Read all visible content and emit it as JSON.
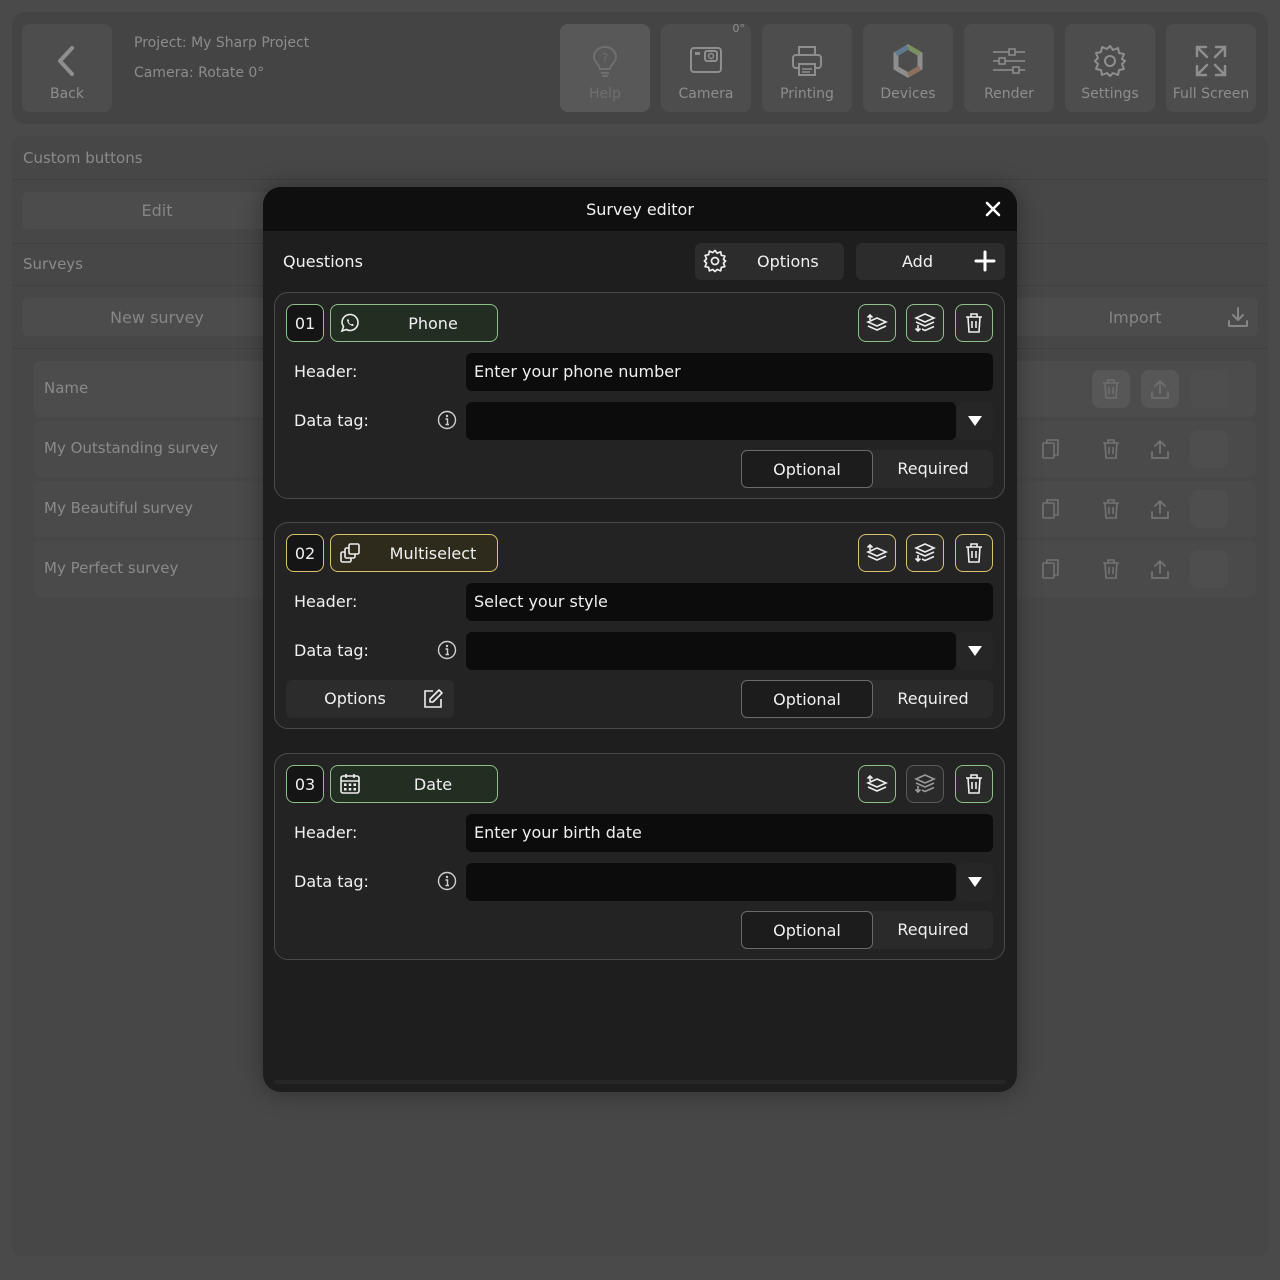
{
  "topbar": {
    "back_label": "Back",
    "project_line": "Project: My Sharp Project",
    "camera_line": "Camera: Rotate 0°",
    "camera_rotation_badge": "0°",
    "buttons": {
      "help": "Help",
      "camera": "Camera",
      "printing": "Printing",
      "devices": "Devices",
      "render": "Render",
      "settings": "Settings",
      "fullscreen": "Full Screen"
    },
    "icons": [
      "chevron-left-icon",
      "help-bulb-icon",
      "camera-icon",
      "printer-icon",
      "devices-icon",
      "sliders-icon",
      "gear-icon",
      "expand-icon"
    ]
  },
  "background": {
    "custom_buttons_title": "Custom buttons",
    "edit_label": "Edit",
    "surveys_title": "Surveys",
    "new_survey_label": "New survey",
    "import_label": "Import",
    "name_header": "Name",
    "surveys": [
      "My Outstanding survey",
      "My Beautiful survey",
      "My Perfect survey"
    ]
  },
  "modal": {
    "title": "Survey editor",
    "questions_label": "Questions",
    "options_label": "Options",
    "add_label": "Add",
    "header_label": "Header:",
    "data_tag_label": "Data tag:",
    "optional_label": "Optional",
    "required_label": "Required",
    "options_button_label": "Options",
    "questions": [
      {
        "number": "01",
        "type": "Phone",
        "type_icon": "whatsapp-phone-icon",
        "header": "Enter your phone number",
        "data_tag": "",
        "requirement": "Optional",
        "accent": "#8fbf8a"
      },
      {
        "number": "02",
        "type": "Multiselect",
        "type_icon": "multiselect-icon",
        "header": "Select your style",
        "data_tag": "",
        "requirement": "Optional",
        "accent": "#d9c36a"
      },
      {
        "number": "03",
        "type": "Date",
        "type_icon": "calendar-icon",
        "header": "Enter your birth date",
        "data_tag": "",
        "requirement": "Optional",
        "accent": "#8fbf8a"
      }
    ]
  },
  "colors": {
    "backdrop": "#4a4a4a",
    "modal_bg": "#1e1e1e",
    "modal_header": "#0f0f0f",
    "accent_green": "#8fbf8a",
    "accent_yellow": "#d9c36a"
  }
}
